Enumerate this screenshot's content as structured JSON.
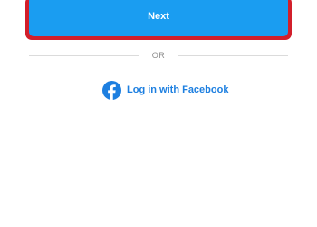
{
  "colors": {
    "primary_button": "#1a9df1",
    "highlight_border": "#d21f2b",
    "divider": "#dbdbdb",
    "facebook_blue": "#1d7fe0",
    "muted_text": "#8e8e8e"
  },
  "login": {
    "next_label": "Next",
    "divider_text": "OR",
    "facebook_label": "Log in with Facebook",
    "facebook_icon": "facebook-icon"
  }
}
